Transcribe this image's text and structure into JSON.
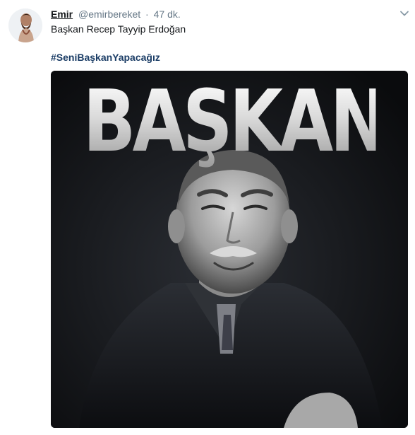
{
  "tweet": {
    "author": {
      "name": "Emir",
      "handle": "@emirbereket",
      "separator": "·",
      "time": "47 dk.",
      "avatar_icon": "avatar-photo"
    },
    "text": "Başkan Recep Tayyip Erdoğan",
    "hashtag": "#SeniBaşkanYapacağız",
    "media": {
      "overlay_word": "BAŞKAN"
    },
    "menu_icon": "chevron-down-icon"
  },
  "colors": {
    "name": "#14171a",
    "meta": "#657786",
    "hashtag": "#1b3d66",
    "media_bg": "#0e0f12"
  }
}
